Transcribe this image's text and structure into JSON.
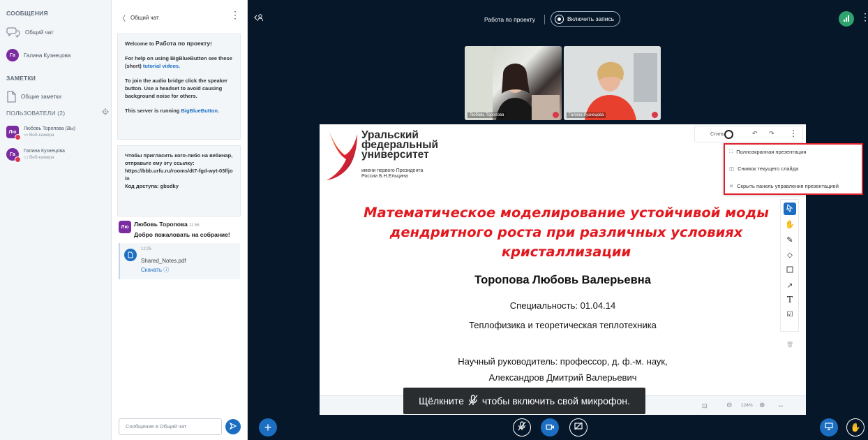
{
  "sidebar": {
    "messages_header": "СООБЩЕНИЯ",
    "public_chat": "Общий чат",
    "private_chat_user": "Галина Кузнецова",
    "private_chat_initials": "Га",
    "notes_header": "ЗАМЕТКИ",
    "shared_notes": "Общие заметки",
    "users_header": "ПОЛЬЗОВАТЕЛИ (2)",
    "users": [
      {
        "initials": "Лю",
        "name": "Любовь Торопова",
        "you": "(Вы)",
        "status": "Веб-камера"
      },
      {
        "initials": "Га",
        "name": "Галина Кузнецова",
        "you": "",
        "status": "Веб-камера"
      }
    ]
  },
  "chat": {
    "back_title": "Общий чат",
    "welcome": {
      "prefix": "Welcome to ",
      "meeting": "Работа по проекту",
      "suffix": "!",
      "help_prefix": "For help on using BigBlueButton see these (short) ",
      "help_link": "tutorial videos.",
      "audio": "To join the audio bridge click the speaker button. Use a headset to avoid causing background noise for others.",
      "running_prefix": "This server is running ",
      "running_link": "BigBlueButton."
    },
    "invite": {
      "text": "Чтобы пригласить кого-либо на вебинар, отправьте ему эту ссылку:",
      "url": "https://bbb.urfu.ru/rooms/dt7-fgd-wyt-03f/join",
      "code": "Код доступа: gbsdky"
    },
    "message": {
      "initials": "Лю",
      "author": "Любовь Торопова",
      "time": "11:56",
      "text": "Добро пожаловать на собрание!"
    },
    "file": {
      "time": "12:05",
      "name": "Shared_Notes.pdf",
      "download": "Скачать"
    },
    "input_placeholder": "Сообщение в Общий чат"
  },
  "topbar": {
    "title": "Работа по проекту",
    "record_label": "Включить запись"
  },
  "videos": [
    {
      "name": "Любовь Торопова"
    },
    {
      "name": "Галина Кузнецова"
    }
  ],
  "slide": {
    "uni_line1": "Уральский",
    "uni_line2": "федеральный",
    "uni_line3": "университет",
    "uni_sub1": "имени первого Президента",
    "uni_sub2": "России Б.Н.Ельцина",
    "title": "Математическое моделирование устойчивой моды дендритного роста при различных условиях кристаллизации",
    "author": "Торопова Любовь Валерьевна",
    "specialty": "Специальность: 01.04.14",
    "field": "Теплофизика и теоретическая теплотехника",
    "advisor_line1": "Научный руководитель: профессор, д. ф.-м. наук,",
    "advisor_line2": "Александров Дмитрий Валерьевич"
  },
  "style_bar": {
    "label": "Стиль"
  },
  "menu": {
    "fullscreen": "Полноэкранная презентация",
    "snapshot": "Снимок текущего слайда",
    "hide_panel": "Скрыть панель управления презентацией"
  },
  "slide_footer": {
    "zoom": "124%"
  },
  "mic_toast": {
    "before": "Щёлкните",
    "after": "чтобы включить свой микрофон."
  },
  "colors": {
    "accent": "#1B6EC2",
    "background": "#06172A",
    "title_red": "#E2181F",
    "green": "#2EA36B"
  }
}
